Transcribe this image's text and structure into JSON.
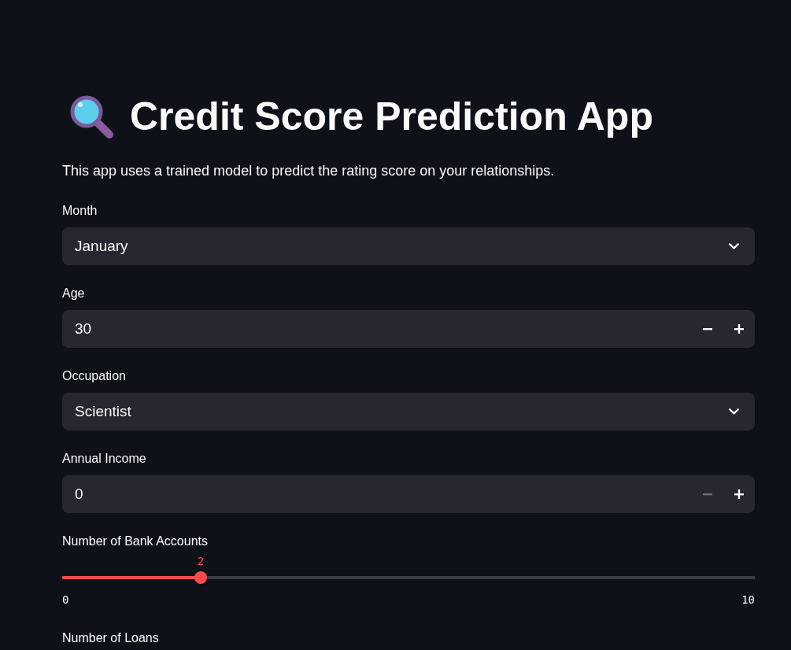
{
  "title": "Credit Score Prediction App",
  "description": "This app uses a trained model to predict the rating score on your relationships.",
  "fields": [
    {
      "kind": "select",
      "label": "Month",
      "value": "January"
    },
    {
      "kind": "number",
      "label": "Age",
      "value": "30",
      "decrement": {
        "disabled": false
      },
      "increment": {
        "disabled": false
      }
    },
    {
      "kind": "select",
      "label": "Occupation",
      "value": "Scientist"
    },
    {
      "kind": "number",
      "label": "Annual Income",
      "value": "0",
      "decrement": {
        "disabled": true
      },
      "increment": {
        "disabled": false
      }
    },
    {
      "kind": "slider",
      "label": "Number of Bank Accounts",
      "value": "2",
      "level": 0.2,
      "min": "0",
      "max": "10"
    },
    {
      "kind": "label",
      "label": "Number of Loans"
    }
  ]
}
